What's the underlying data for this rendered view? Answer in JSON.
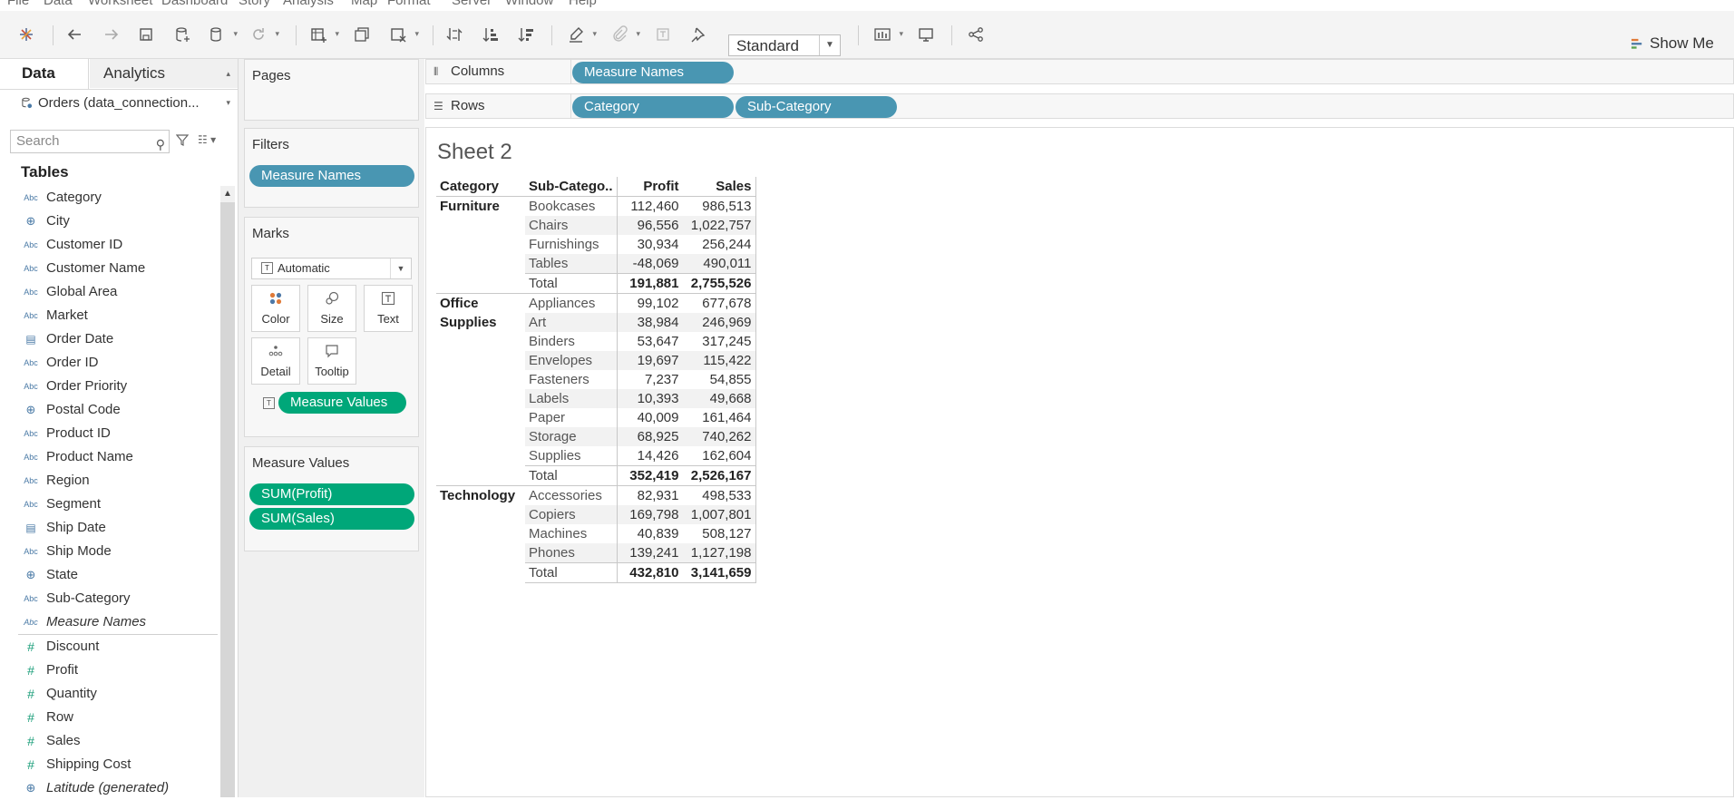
{
  "menu": [
    "File",
    "Data",
    "Worksheet",
    "Dashboard",
    "Story",
    "Analysis",
    "Map",
    "Format",
    "Server",
    "Window",
    "Help"
  ],
  "toolbar": {
    "fit_value": "Standard",
    "show_me_label": "Show Me"
  },
  "data_pane": {
    "tab_data": "Data",
    "tab_analytics": "Analytics",
    "datasource": "Orders (data_connection...",
    "search_placeholder": "Search",
    "tables_heading": "Tables",
    "fields": [
      {
        "name": "Category",
        "type": "Abc"
      },
      {
        "name": "City",
        "type": "globe"
      },
      {
        "name": "Customer ID",
        "type": "Abc"
      },
      {
        "name": "Customer Name",
        "type": "Abc"
      },
      {
        "name": "Global Area",
        "type": "Abc"
      },
      {
        "name": "Market",
        "type": "Abc"
      },
      {
        "name": "Order Date",
        "type": "calendar"
      },
      {
        "name": "Order ID",
        "type": "Abc"
      },
      {
        "name": "Order Priority",
        "type": "Abc"
      },
      {
        "name": "Postal Code",
        "type": "globe"
      },
      {
        "name": "Product ID",
        "type": "Abc"
      },
      {
        "name": "Product Name",
        "type": "Abc"
      },
      {
        "name": "Region",
        "type": "Abc"
      },
      {
        "name": "Segment",
        "type": "Abc"
      },
      {
        "name": "Ship Date",
        "type": "calendar"
      },
      {
        "name": "Ship Mode",
        "type": "Abc"
      },
      {
        "name": "State",
        "type": "globe"
      },
      {
        "name": "Sub-Category",
        "type": "Abc"
      },
      {
        "name": "Measure Names",
        "type": "Abc"
      }
    ],
    "measures": [
      {
        "name": "Discount",
        "type": "#"
      },
      {
        "name": "Profit",
        "type": "#"
      },
      {
        "name": "Quantity",
        "type": "#"
      },
      {
        "name": "Row",
        "type": "#"
      },
      {
        "name": "Sales",
        "type": "#"
      },
      {
        "name": "Shipping Cost",
        "type": "#"
      },
      {
        "name": "Latitude (generated)",
        "type": "globe"
      }
    ]
  },
  "cards": {
    "pages_title": "Pages",
    "filters_title": "Filters",
    "filters_pill": "Measure Names",
    "marks_title": "Marks",
    "mark_type": "Automatic",
    "mark_buttons": {
      "color": "Color",
      "size": "Size",
      "text": "Text",
      "detail": "Detail",
      "tooltip": "Tooltip"
    },
    "marks_pill": "Measure Values",
    "measure_values_title": "Measure Values",
    "mv_pills": [
      "SUM(Profit)",
      "SUM(Sales)"
    ]
  },
  "shelves": {
    "columns_label": "Columns",
    "columns_pills": [
      "Measure Names"
    ],
    "rows_label": "Rows",
    "rows_pills": [
      "Category",
      "Sub-Category"
    ]
  },
  "view": {
    "sheet_title": "Sheet 2",
    "headers": {
      "category": "Category",
      "subcategory": "Sub-Catego..",
      "profit": "Profit",
      "sales": "Sales"
    },
    "groups": [
      {
        "category": "Furniture",
        "rows": [
          {
            "sub": "Bookcases",
            "profit": "112,460",
            "sales": "986,513"
          },
          {
            "sub": "Chairs",
            "profit": "96,556",
            "sales": "1,022,757"
          },
          {
            "sub": "Furnishings",
            "profit": "30,934",
            "sales": "256,244"
          },
          {
            "sub": "Tables",
            "profit": "-48,069",
            "sales": "490,011"
          }
        ],
        "total": {
          "label": "Total",
          "profit": "191,881",
          "sales": "2,755,526"
        }
      },
      {
        "category": "Office Supplies",
        "rows": [
          {
            "sub": "Appliances",
            "profit": "99,102",
            "sales": "677,678"
          },
          {
            "sub": "Art",
            "profit": "38,984",
            "sales": "246,969"
          },
          {
            "sub": "Binders",
            "profit": "53,647",
            "sales": "317,245"
          },
          {
            "sub": "Envelopes",
            "profit": "19,697",
            "sales": "115,422"
          },
          {
            "sub": "Fasteners",
            "profit": "7,237",
            "sales": "54,855"
          },
          {
            "sub": "Labels",
            "profit": "10,393",
            "sales": "49,668"
          },
          {
            "sub": "Paper",
            "profit": "40,009",
            "sales": "161,464"
          },
          {
            "sub": "Storage",
            "profit": "68,925",
            "sales": "740,262"
          },
          {
            "sub": "Supplies",
            "profit": "14,426",
            "sales": "162,604"
          }
        ],
        "total": {
          "label": "Total",
          "profit": "352,419",
          "sales": "2,526,167"
        }
      },
      {
        "category": "Technology",
        "rows": [
          {
            "sub": "Accessories",
            "profit": "82,931",
            "sales": "498,533"
          },
          {
            "sub": "Copiers",
            "profit": "169,798",
            "sales": "1,007,801"
          },
          {
            "sub": "Machines",
            "profit": "40,839",
            "sales": "508,127"
          },
          {
            "sub": "Phones",
            "profit": "139,241",
            "sales": "1,127,198"
          }
        ],
        "total": {
          "label": "Total",
          "profit": "432,810",
          "sales": "3,141,659"
        }
      }
    ]
  },
  "colors": {
    "dimension_pill": "#4996b2",
    "measure_pill": "#00a779"
  }
}
